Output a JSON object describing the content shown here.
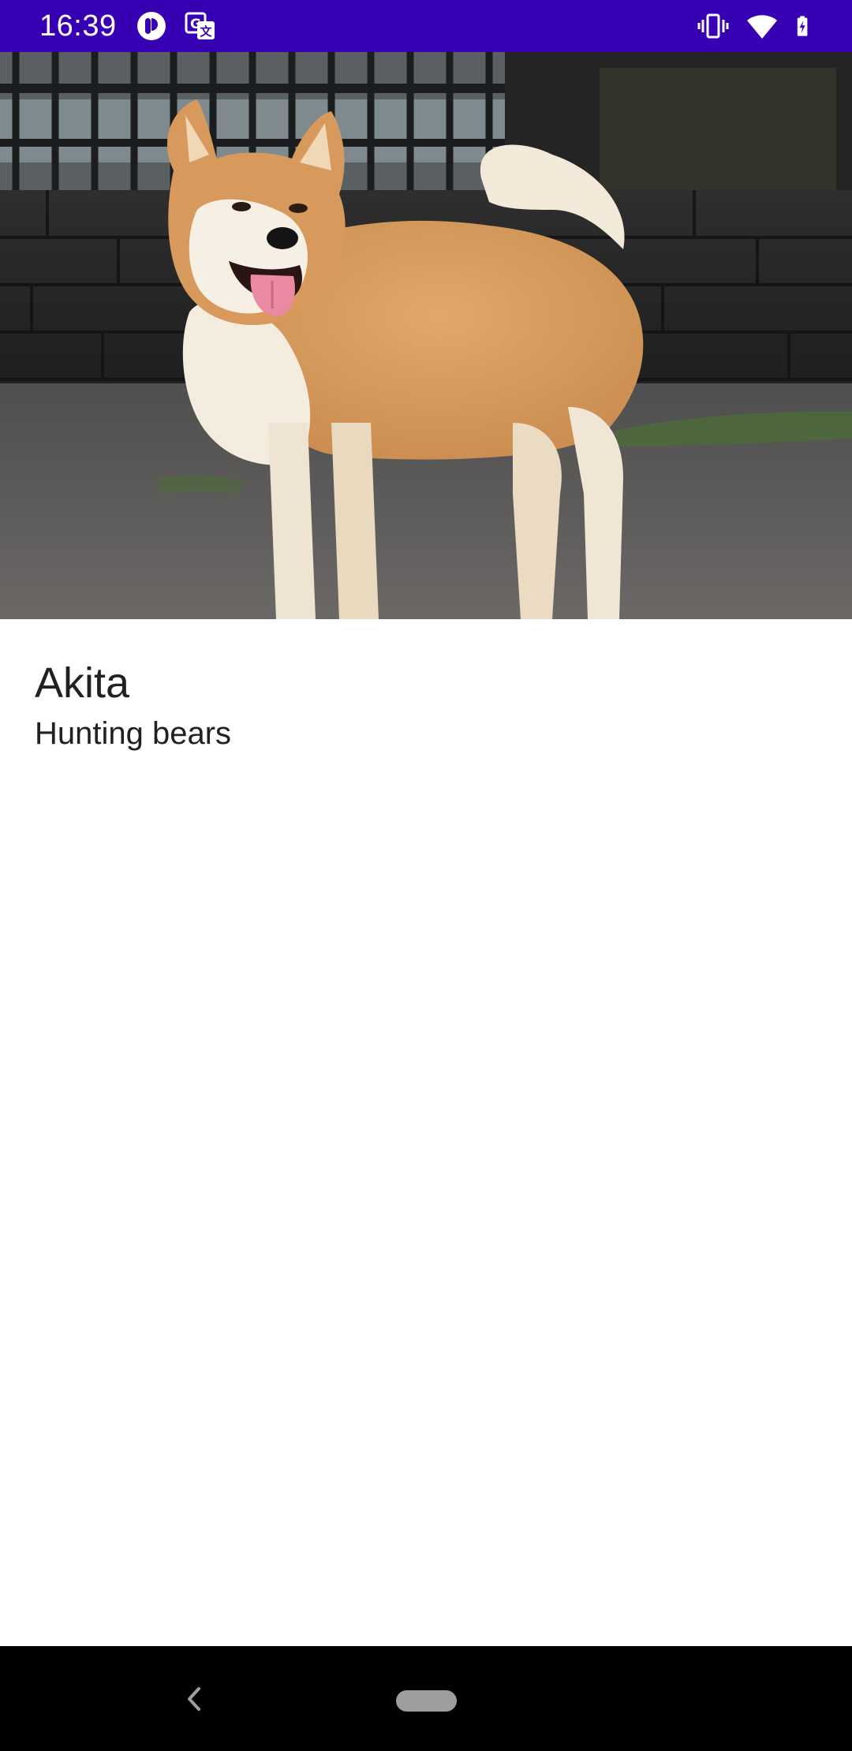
{
  "status_bar": {
    "time": "16:39",
    "background_color": "#3700b3",
    "left_icons": [
      "app-notification-icon",
      "translate-icon"
    ],
    "right_icons": [
      "vibrate-icon",
      "wifi-icon",
      "battery-charging-icon"
    ]
  },
  "hero": {
    "subject": "Akita dog standing on pavement in front of a wrought-iron fence",
    "alt": "Akita"
  },
  "detail": {
    "name": "Akita",
    "purpose": "Hunting bears"
  },
  "nav_bar": {
    "background_color": "#000000",
    "back_icon": "back-chevron-icon",
    "home_pill": "home-pill"
  }
}
